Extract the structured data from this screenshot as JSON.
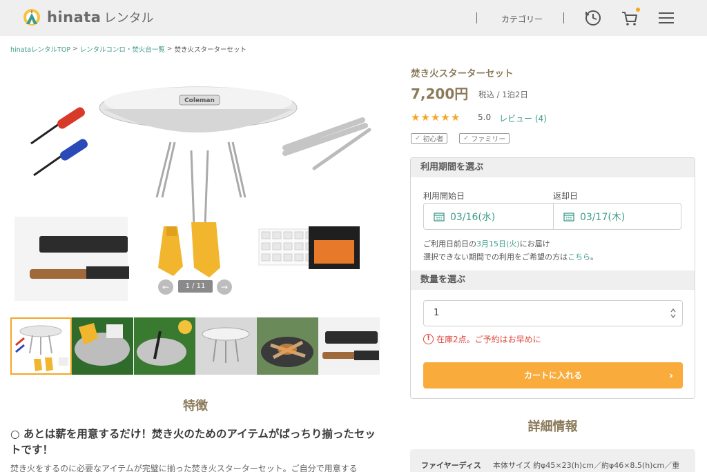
{
  "header": {
    "logo_text": "hinata",
    "logo_sub": "レンタル",
    "category_label": "カテゴリー"
  },
  "breadcrumb": {
    "items": [
      "hinataレンタルTOP",
      "レンタルコンロ・焚火台一覧",
      "焚き火スターターセット"
    ]
  },
  "gallery": {
    "counter": "1 / 11",
    "thumbnail_count": 6
  },
  "product": {
    "title": "焚き火スターターセット",
    "price": "7,200円",
    "price_note": "税込 / 1泊2日",
    "rating": 5.0,
    "rating_text": "5.0",
    "review_link": "レビュー (4)",
    "tags": [
      "初心者",
      "ファミリー"
    ]
  },
  "rental": {
    "period_heading": "利用期間を選ぶ",
    "start_label": "利用開始日",
    "return_label": "返却日",
    "start_date": "03/16(水)",
    "return_date": "03/17(木)",
    "note1_pre": "ご利用日前日の",
    "note1_date": "3月15日(火)",
    "note1_post": "にお届け",
    "note2_pre": "選択できない期間での利用をご希望の方は",
    "note2_link": "こちら",
    "note2_post": "。",
    "qty_heading": "数量を選ぶ",
    "qty_value": "1",
    "stock_text": "在庫2点。ご予約はお早めに",
    "cart_button": "カートに入れる"
  },
  "features": {
    "title": "特徴",
    "headline": "○ あとは薪を用意するだけ！焚き火のためのアイテムがばっちり揃ったセットです！",
    "body": "焚き火をするのに必要なアイテムが完璧に揃った焚き火スターターセット。ご自分で用意する"
  },
  "details": {
    "title": "詳細情報",
    "label": "ファイヤーディス",
    "value": "本体サイズ 約φ45×23(h)cm／約φ46×8.5(h)cm／重"
  },
  "colors": {
    "accent": "#f9ab3b",
    "link": "#3d9b8a",
    "heading": "#8a7a5a",
    "alert": "#e0453a"
  }
}
